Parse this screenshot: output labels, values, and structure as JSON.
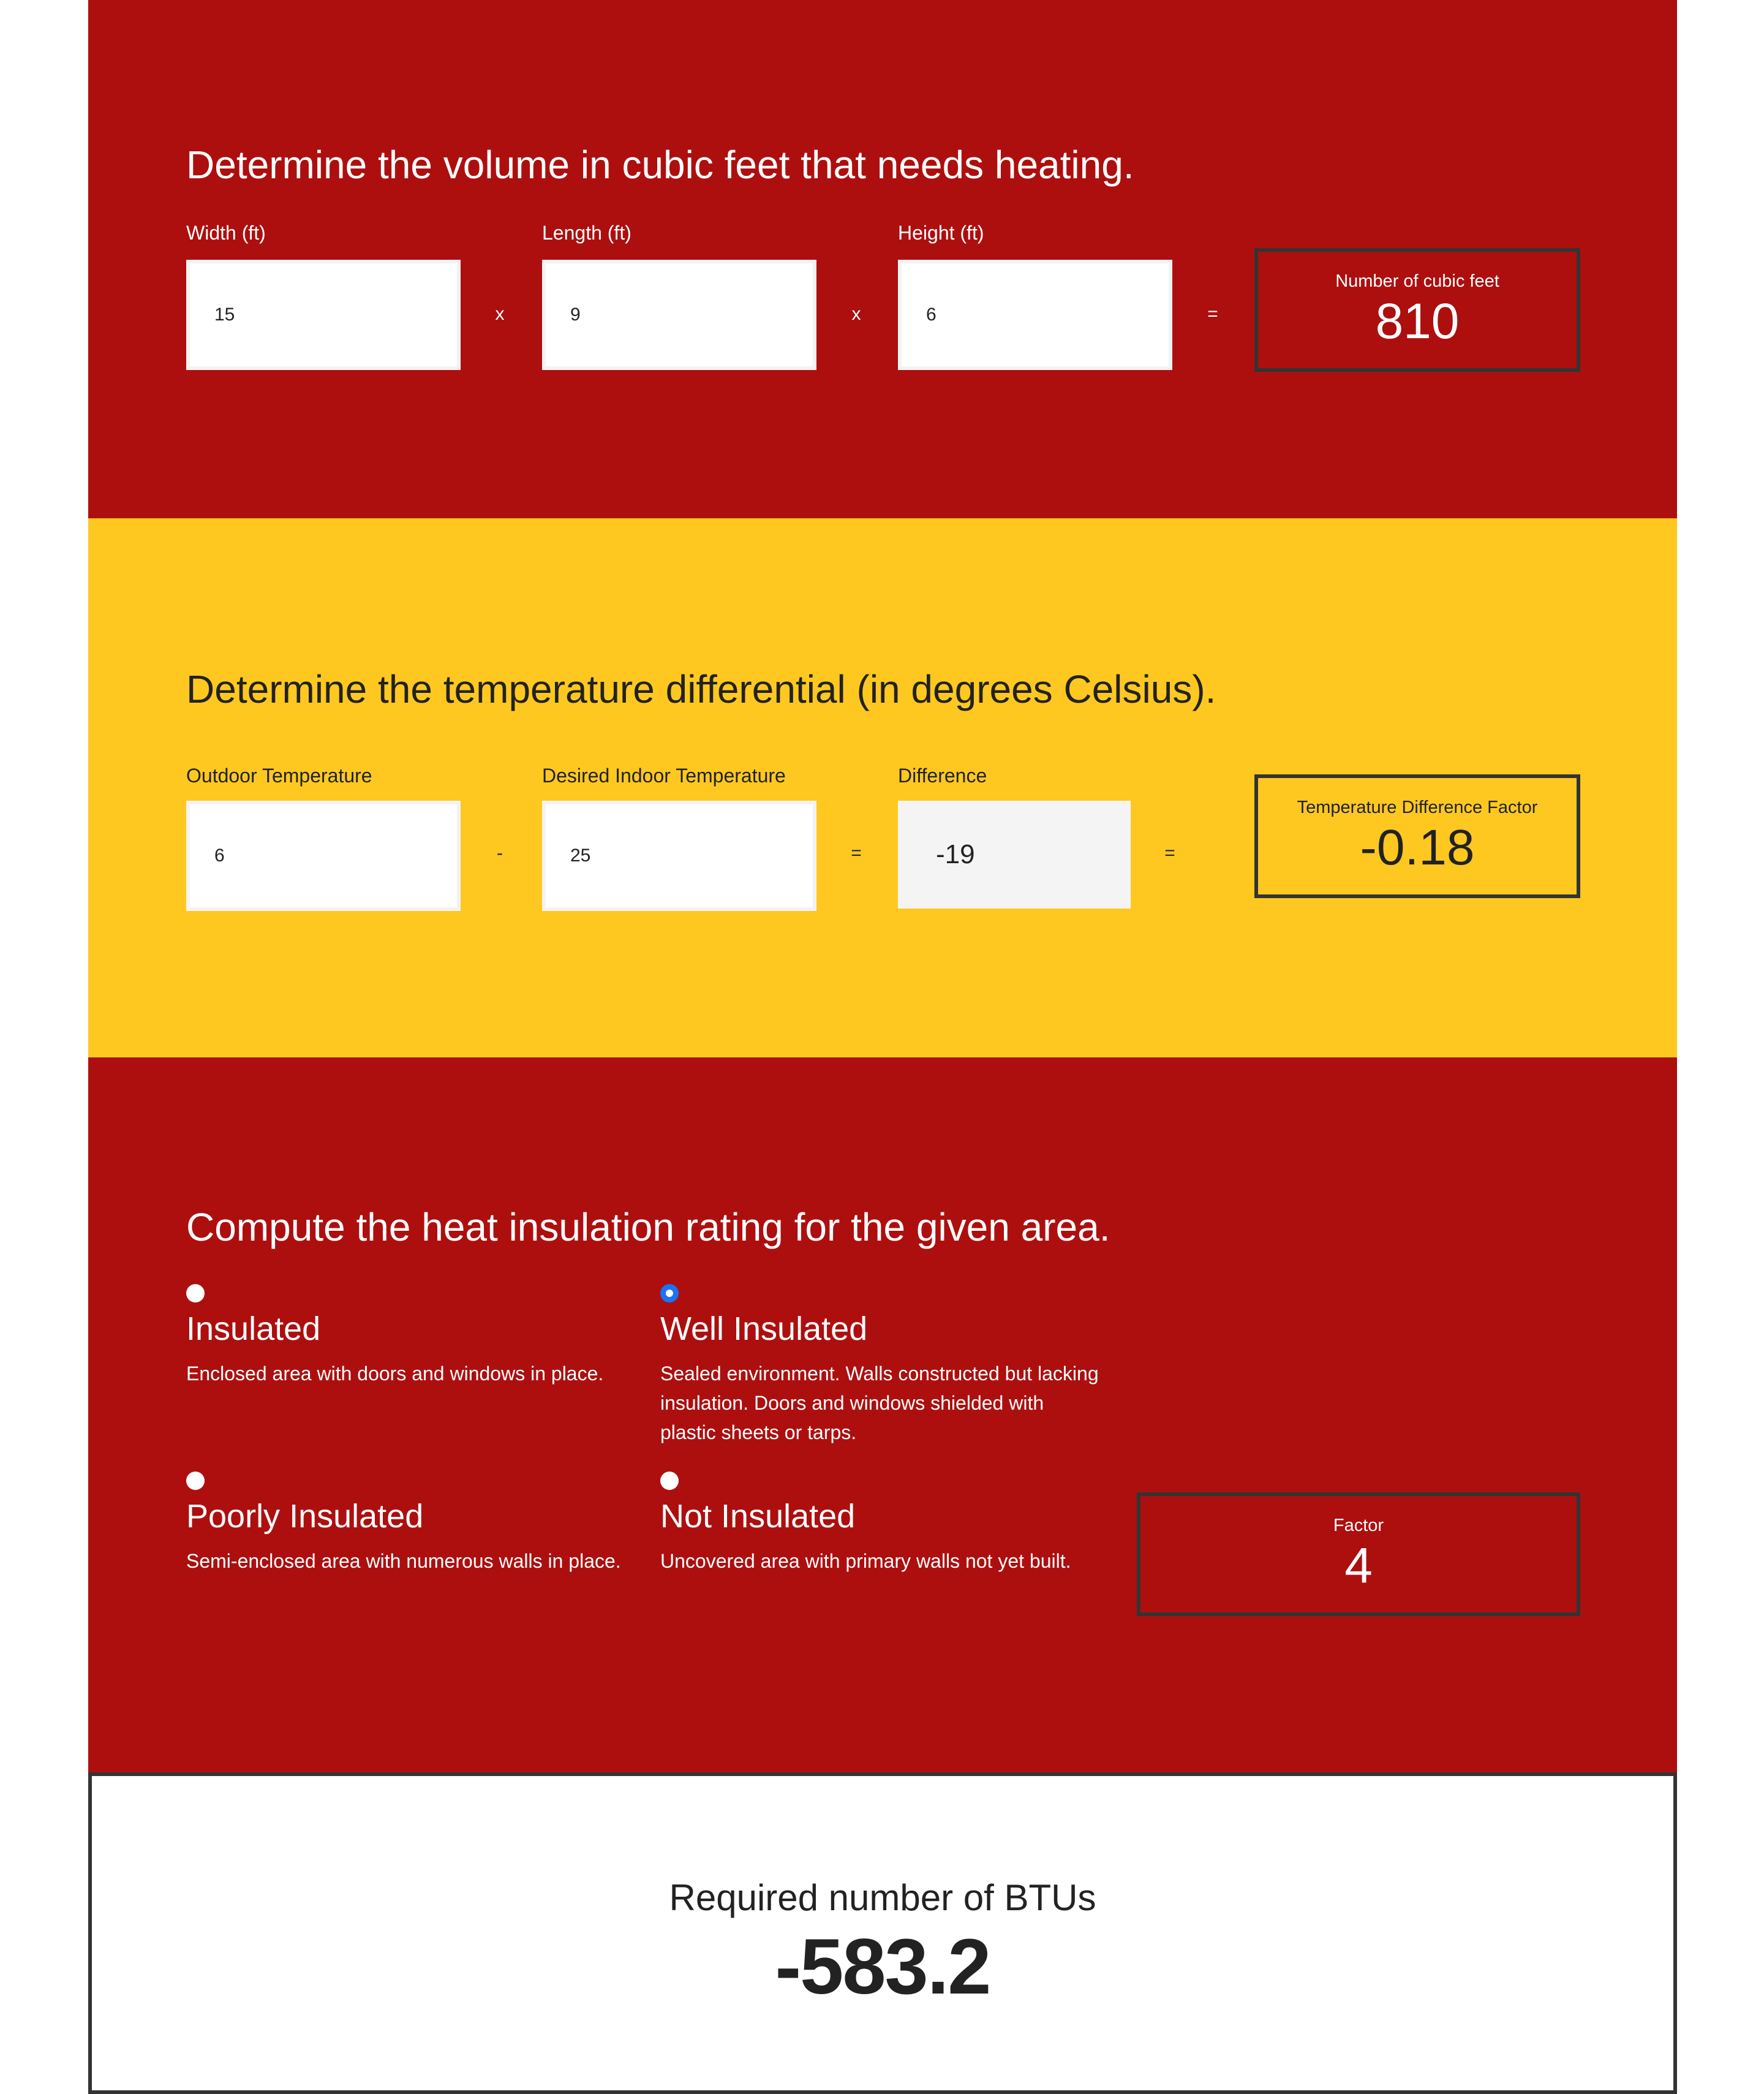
{
  "colors": {
    "red_section": "#ad0f0f",
    "yellow_section": "#fec821",
    "box_border": "#333333",
    "radio_checked": "#1a73f5"
  },
  "volume": {
    "heading": "Determine the volume in cubic feet that needs heating.",
    "width": {
      "label": "Width (ft)",
      "value": "15"
    },
    "length": {
      "label": "Length (ft)",
      "value": "9"
    },
    "height": {
      "label": "Height (ft)",
      "value": "6"
    },
    "op1": "x",
    "op2": "x",
    "op3": "=",
    "result": {
      "label": "Number of cubic feet",
      "value": "810"
    }
  },
  "temperature": {
    "heading": "Determine the temperature differential (in degrees Celsius).",
    "outdoor": {
      "label": "Outdoor Temperature",
      "value": "6"
    },
    "indoor": {
      "label": "Desired Indoor Temperature",
      "value": "25"
    },
    "difference": {
      "label": "Difference",
      "value": "-19"
    },
    "op1": "-",
    "op2": "=",
    "op3": "=",
    "result": {
      "label": "Temperature Difference Factor",
      "value": "-0.18"
    }
  },
  "insulation": {
    "heading": "Compute the heat insulation rating for the given area.",
    "options": [
      {
        "title": "Insulated",
        "description": "Enclosed area with doors and windows in place.",
        "checked": false
      },
      {
        "title": "Well Insulated",
        "description": "Sealed environment. Walls constructed but lacking insulation. Doors and windows shielded with plastic sheets or tarps.",
        "checked": true
      },
      {
        "title": "Poorly Insulated",
        "description": "Semi-enclosed area with numerous walls in place.",
        "checked": false
      },
      {
        "title": "Not Insulated",
        "description": "Uncovered area with primary walls not yet built.",
        "checked": false
      }
    ],
    "result": {
      "label": "Factor",
      "value": "4"
    }
  },
  "btu": {
    "label": "Required number of BTUs",
    "value": "-583.2"
  }
}
